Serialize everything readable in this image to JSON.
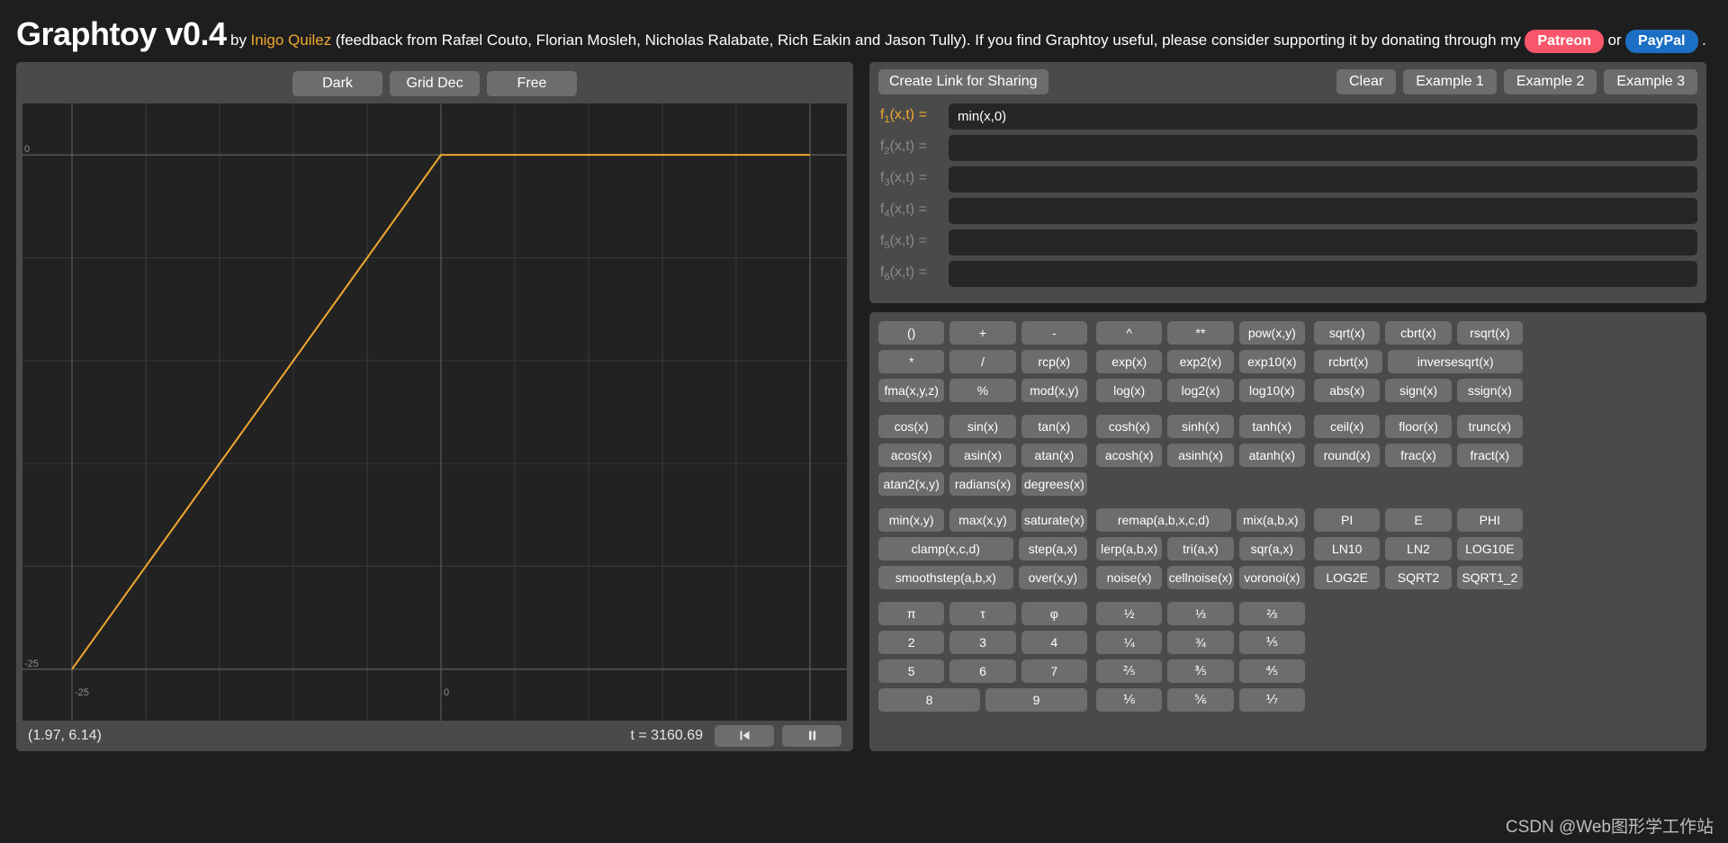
{
  "header": {
    "app_title": "Graphtoy v0.4",
    "by_text": "by",
    "author": "Inigo Quilez",
    "credits": "(feedback from Rafæl Couto, Florian Mosleh, Nicholas Ralabate, Rich Eakin and Jason Tully). If you find Graphtoy useful, please consider supporting it by donating through my",
    "patreon_label": "Patreon",
    "or_text": "or",
    "paypal_label": "PayPal",
    "period": ".",
    "accent_color": "#f0a830",
    "patreon_color": "#f9566b",
    "paypal_color": "#1b6fc4"
  },
  "graph": {
    "toolbar": {
      "theme_button": "Dark",
      "grid_button": "Grid Dec",
      "mode_button": "Free"
    },
    "axis_labels": {
      "y_top": "0",
      "y_bottom": "-25",
      "x_left": "-25",
      "x_right": "0"
    },
    "status": {
      "coordinates": "(1.97, 6.14)",
      "time": "t = 3160.69",
      "rewind_icon": "⧏|",
      "pause_icon": "||"
    },
    "curve_color": "#f0a830",
    "grid_color": "#3a3a3a",
    "background": "#222222"
  },
  "chart_data": {
    "type": "line",
    "title": "",
    "xlabel": "",
    "ylabel": "",
    "function": "min(x,0)",
    "series": [
      {
        "name": "f1",
        "color": "#f0a830",
        "points": [
          [
            -25.0,
            -25.0
          ],
          [
            0.0,
            0.0
          ],
          [
            25.0,
            0.0
          ]
        ]
      }
    ],
    "xlim": [
      -27.5,
      27.5
    ],
    "ylim": [
      -27.5,
      2.5
    ],
    "grid": true,
    "tick_labels_x": [
      "-25",
      "0"
    ],
    "tick_labels_y": [
      "0",
      "-25"
    ]
  },
  "formulas": {
    "toolbar": {
      "share_label": "Create Link for Sharing",
      "clear_label": "Clear",
      "example1_label": "Example 1",
      "example2_label": "Example 2",
      "example3_label": "Example 3"
    },
    "rows": [
      {
        "label": "f",
        "index": "1",
        "args": "(x,t) =",
        "value": "min(x,0)",
        "active": true
      },
      {
        "label": "f",
        "index": "2",
        "args": "(x,t) =",
        "value": "",
        "active": false
      },
      {
        "label": "f",
        "index": "3",
        "args": "(x,t) =",
        "value": "",
        "active": false
      },
      {
        "label": "f",
        "index": "4",
        "args": "(x,t) =",
        "value": "",
        "active": false
      },
      {
        "label": "f",
        "index": "5",
        "args": "(x,t) =",
        "value": "",
        "active": false
      },
      {
        "label": "f",
        "index": "6",
        "args": "(x,t) =",
        "value": "",
        "active": false
      }
    ],
    "active_label_color": "#f0a830",
    "inactive_label_color": "#8a8a8a"
  },
  "keypad": {
    "groups": [
      {
        "name": "arithmetic",
        "rows": [
          {
            "colA": [
              {
                "label": "()",
                "w": "w1"
              },
              {
                "label": "+",
                "w": "w1"
              },
              {
                "label": "-",
                "w": "w1"
              }
            ],
            "colB": [
              {
                "label": "^",
                "w": "w1"
              },
              {
                "label": "**",
                "w": "w1"
              },
              {
                "label": "pow(x,y)",
                "w": "w1"
              }
            ],
            "colC": [
              {
                "label": "sqrt(x)",
                "w": "w1"
              },
              {
                "label": "cbrt(x)",
                "w": "w1"
              },
              {
                "label": "rsqrt(x)",
                "w": "w1"
              }
            ]
          },
          {
            "colA": [
              {
                "label": "*",
                "w": "w1"
              },
              {
                "label": "/",
                "w": "w1"
              },
              {
                "label": "rcp(x)",
                "w": "w1"
              }
            ],
            "colB": [
              {
                "label": "exp(x)",
                "w": "w1"
              },
              {
                "label": "exp2(x)",
                "w": "w1"
              },
              {
                "label": "exp10(x)",
                "w": "w1"
              }
            ],
            "colC": [
              {
                "label": "rcbrt(x)",
                "w": "w1"
              },
              {
                "label": "inversesqrt(x)",
                "w": "w2"
              }
            ]
          },
          {
            "colA": [
              {
                "label": "fma(x,y,z)",
                "w": "w1"
              },
              {
                "label": "%",
                "w": "w1"
              },
              {
                "label": "mod(x,y)",
                "w": "w1"
              }
            ],
            "colB": [
              {
                "label": "log(x)",
                "w": "w1"
              },
              {
                "label": "log2(x)",
                "w": "w1"
              },
              {
                "label": "log10(x)",
                "w": "w1"
              }
            ],
            "colC": [
              {
                "label": "abs(x)",
                "w": "w1"
              },
              {
                "label": "sign(x)",
                "w": "w1"
              },
              {
                "label": "ssign(x)",
                "w": "w1"
              }
            ]
          }
        ]
      },
      {
        "name": "trigonometry",
        "rows": [
          {
            "colA": [
              {
                "label": "cos(x)",
                "w": "w1"
              },
              {
                "label": "sin(x)",
                "w": "w1"
              },
              {
                "label": "tan(x)",
                "w": "w1"
              }
            ],
            "colB": [
              {
                "label": "cosh(x)",
                "w": "w1"
              },
              {
                "label": "sinh(x)",
                "w": "w1"
              },
              {
                "label": "tanh(x)",
                "w": "w1"
              }
            ],
            "colC": [
              {
                "label": "ceil(x)",
                "w": "w1"
              },
              {
                "label": "floor(x)",
                "w": "w1"
              },
              {
                "label": "trunc(x)",
                "w": "w1"
              }
            ]
          },
          {
            "colA": [
              {
                "label": "acos(x)",
                "w": "w1"
              },
              {
                "label": "asin(x)",
                "w": "w1"
              },
              {
                "label": "atan(x)",
                "w": "w1"
              }
            ],
            "colB": [
              {
                "label": "acosh(x)",
                "w": "w1"
              },
              {
                "label": "asinh(x)",
                "w": "w1"
              },
              {
                "label": "atanh(x)",
                "w": "w1"
              }
            ],
            "colC": [
              {
                "label": "round(x)",
                "w": "w1"
              },
              {
                "label": "frac(x)",
                "w": "w1"
              },
              {
                "label": "fract(x)",
                "w": "w1"
              }
            ]
          },
          {
            "colA": [
              {
                "label": "atan2(x,y)",
                "w": "w1"
              },
              {
                "label": "radians(x)",
                "w": "w1"
              },
              {
                "label": "degrees(x)",
                "w": "w1"
              }
            ],
            "colB": [],
            "colC": []
          }
        ]
      },
      {
        "name": "utility",
        "rows": [
          {
            "colA": [
              {
                "label": "min(x,y)",
                "w": "w1"
              },
              {
                "label": "max(x,y)",
                "w": "w1"
              },
              {
                "label": "saturate(x)",
                "w": "w1"
              }
            ],
            "colB": [
              {
                "label": "remap(a,b,x,c,d)",
                "w": "w2"
              },
              {
                "label": "mix(a,b,x)",
                "w": "w1"
              }
            ],
            "colC": [
              {
                "label": "PI",
                "w": "w1"
              },
              {
                "label": "E",
                "w": "w1"
              },
              {
                "label": "PHI",
                "w": "w1"
              }
            ]
          },
          {
            "colA": [
              {
                "label": "clamp(x,c,d)",
                "w": "w2"
              },
              {
                "label": "step(a,x)",
                "w": "w1"
              }
            ],
            "colB": [
              {
                "label": "lerp(a,b,x)",
                "w": "w1"
              },
              {
                "label": "tri(a,x)",
                "w": "w1"
              },
              {
                "label": "sqr(a,x)",
                "w": "w1"
              }
            ],
            "colC": [
              {
                "label": "LN10",
                "w": "w1"
              },
              {
                "label": "LN2",
                "w": "w1"
              },
              {
                "label": "LOG10E",
                "w": "w1"
              }
            ]
          },
          {
            "colA": [
              {
                "label": "smoothstep(a,b,x)",
                "w": "w2"
              },
              {
                "label": "over(x,y)",
                "w": "w1"
              }
            ],
            "colB": [
              {
                "label": "noise(x)",
                "w": "w1"
              },
              {
                "label": "cellnoise(x)",
                "w": "w1"
              },
              {
                "label": "voronoi(x)",
                "w": "w1"
              }
            ],
            "colC": [
              {
                "label": "LOG2E",
                "w": "w1"
              },
              {
                "label": "SQRT2",
                "w": "w1"
              },
              {
                "label": "SQRT1_2",
                "w": "w1"
              }
            ]
          }
        ]
      },
      {
        "name": "constants",
        "rows": [
          {
            "colA": [
              {
                "label": "π",
                "w": "w1"
              },
              {
                "label": "τ",
                "w": "w1"
              },
              {
                "label": "φ",
                "w": "w1"
              }
            ],
            "colB": [
              {
                "label": "½",
                "w": "w1"
              },
              {
                "label": "⅓",
                "w": "w1"
              },
              {
                "label": "⅔",
                "w": "w1"
              }
            ],
            "colC": []
          },
          {
            "colA": [
              {
                "label": "2",
                "w": "w1"
              },
              {
                "label": "3",
                "w": "w1"
              },
              {
                "label": "4",
                "w": "w1"
              }
            ],
            "colB": [
              {
                "label": "¼",
                "w": "w1"
              },
              {
                "label": "¾",
                "w": "w1"
              },
              {
                "label": "⅕",
                "w": "w1"
              }
            ],
            "colC": []
          },
          {
            "colA": [
              {
                "label": "5",
                "w": "w1"
              },
              {
                "label": "6",
                "w": "w1"
              },
              {
                "label": "7",
                "w": "w1"
              }
            ],
            "colB": [
              {
                "label": "⅖",
                "w": "w1"
              },
              {
                "label": "⅗",
                "w": "w1"
              },
              {
                "label": "⅘",
                "w": "w1"
              }
            ],
            "colC": []
          },
          {
            "colA": [
              {
                "label": "8",
                "w": "w1"
              },
              {
                "label": "9",
                "w": "w1"
              }
            ],
            "colB": [
              {
                "label": "⅙",
                "w": "w1"
              },
              {
                "label": "⅚",
                "w": "w1"
              },
              {
                "label": "⅐",
                "w": "w1"
              }
            ],
            "colC": []
          }
        ]
      }
    ]
  },
  "watermark": "CSDN @Web图形学工作站"
}
